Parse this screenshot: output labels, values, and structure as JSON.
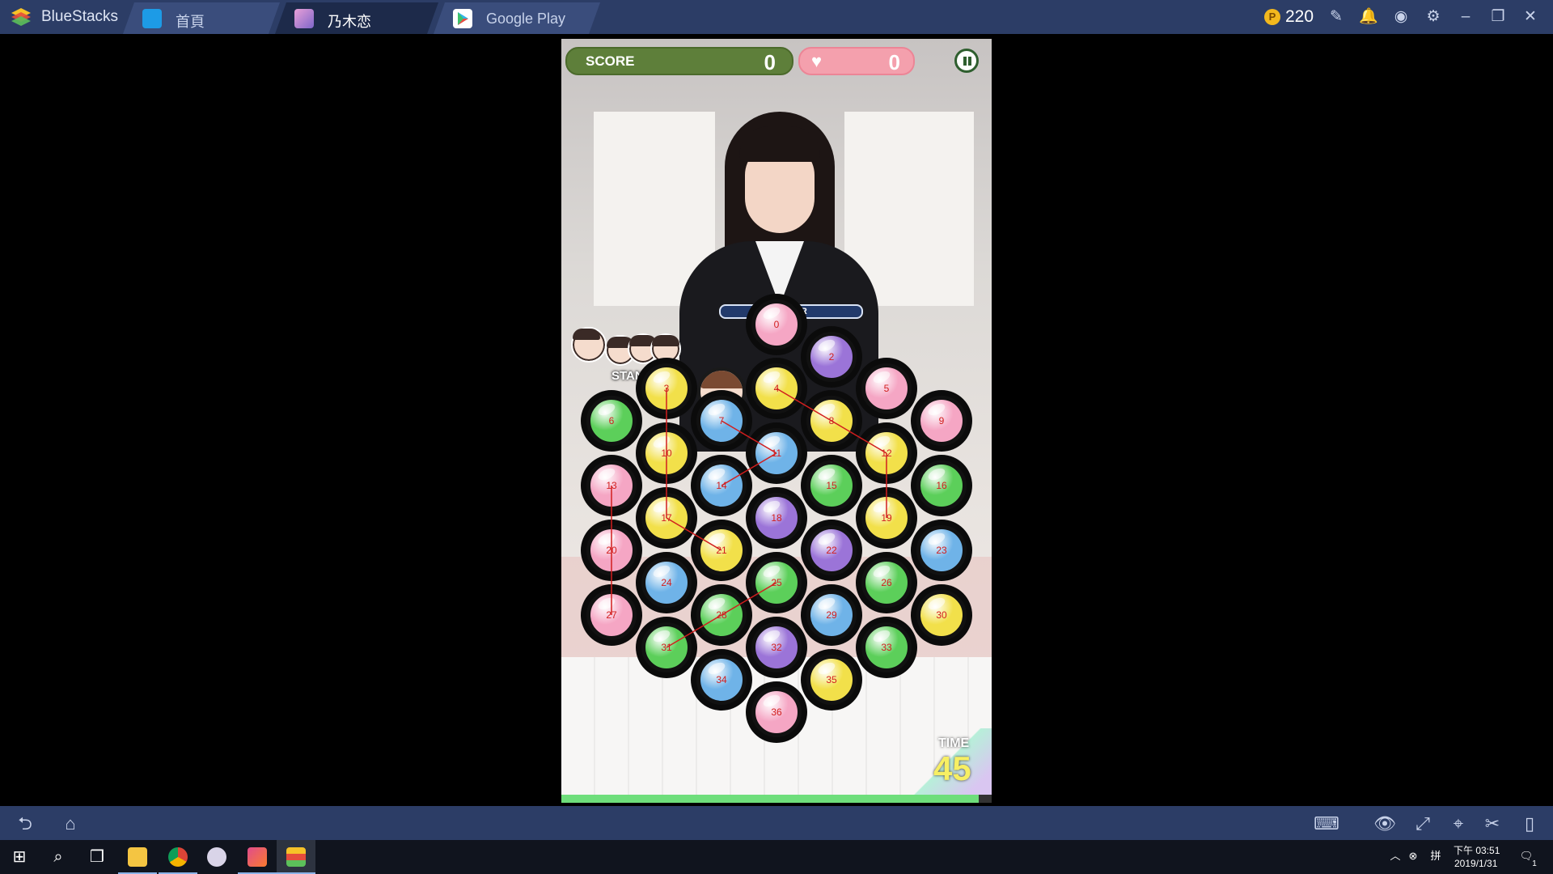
{
  "bluestacks": {
    "app_name": "BlueStacks",
    "tabs": [
      {
        "label": "首頁",
        "icon": "home-icon",
        "active": false
      },
      {
        "label": "乃木恋",
        "icon": "game-icon",
        "active": true
      },
      {
        "label": "Google Play",
        "icon": "google-play-icon",
        "active": false
      }
    ],
    "coins": "220",
    "coin_symbol": "P",
    "toolbar_icons": [
      "pin-icon",
      "bell-icon",
      "account-icon",
      "gear-icon",
      "minimize-icon",
      "restore-icon",
      "close-icon"
    ],
    "bottom_icons": [
      "back-icon",
      "home-icon",
      "keyboard-icon",
      "eye-icon",
      "fullscreen-icon",
      "location-icon",
      "scissors-icon",
      "rotate-icon"
    ]
  },
  "game": {
    "score_label": "SCORE",
    "score_value": "0",
    "hearts_value": "0",
    "fever_label": "FEVER",
    "standby_label": "STANDBY",
    "time_label": "TIME",
    "time_value": "45",
    "time_remaining_fraction": 0.97,
    "board": [
      {
        "n": "0",
        "color": "pink"
      },
      {
        "n": "2",
        "color": "purple"
      },
      {
        "n": "3",
        "color": "yellow"
      },
      {
        "n": "4",
        "color": "yellow"
      },
      {
        "n": "5",
        "color": "pink"
      },
      {
        "n": "6",
        "color": "green"
      },
      {
        "n": "7",
        "color": "blue"
      },
      {
        "n": "8",
        "color": "yellow"
      },
      {
        "n": "9",
        "color": "pink"
      },
      {
        "n": "10",
        "color": "yellow"
      },
      {
        "n": "11",
        "color": "blue"
      },
      {
        "n": "12",
        "color": "yellow"
      },
      {
        "n": "13",
        "color": "pink"
      },
      {
        "n": "14",
        "color": "blue"
      },
      {
        "n": "15",
        "color": "green"
      },
      {
        "n": "16",
        "color": "green"
      },
      {
        "n": "17",
        "color": "yellow"
      },
      {
        "n": "18",
        "color": "purple"
      },
      {
        "n": "19",
        "color": "yellow"
      },
      {
        "n": "20",
        "color": "pink"
      },
      {
        "n": "21",
        "color": "yellow"
      },
      {
        "n": "22",
        "color": "purple"
      },
      {
        "n": "23",
        "color": "blue"
      },
      {
        "n": "24",
        "color": "blue"
      },
      {
        "n": "25",
        "color": "green"
      },
      {
        "n": "26",
        "color": "green"
      },
      {
        "n": "27",
        "color": "pink"
      },
      {
        "n": "28",
        "color": "green"
      },
      {
        "n": "29",
        "color": "blue"
      },
      {
        "n": "30",
        "color": "yellow"
      },
      {
        "n": "31",
        "color": "green"
      },
      {
        "n": "32",
        "color": "purple"
      },
      {
        "n": "33",
        "color": "green"
      },
      {
        "n": "34",
        "color": "blue"
      },
      {
        "n": "35",
        "color": "yellow"
      },
      {
        "n": "36",
        "color": "pink"
      }
    ],
    "link_paths": [
      [
        "3",
        "10",
        "17",
        "21"
      ],
      [
        "4",
        "8",
        "12",
        "19"
      ],
      [
        "7",
        "11",
        "14"
      ],
      [
        "13",
        "20",
        "27"
      ],
      [
        "25",
        "28",
        "31"
      ]
    ],
    "colors": {
      "pink": "#f5a6c4",
      "purple": "#9b74d8",
      "yellow": "#f2e04a",
      "green": "#5ccf5a",
      "blue": "#6fb3e8",
      "link": "#d21e1e"
    }
  },
  "taskbar": {
    "clock_time": "下午 03:51",
    "clock_date": "2019/1/31",
    "notification_count": "1"
  }
}
